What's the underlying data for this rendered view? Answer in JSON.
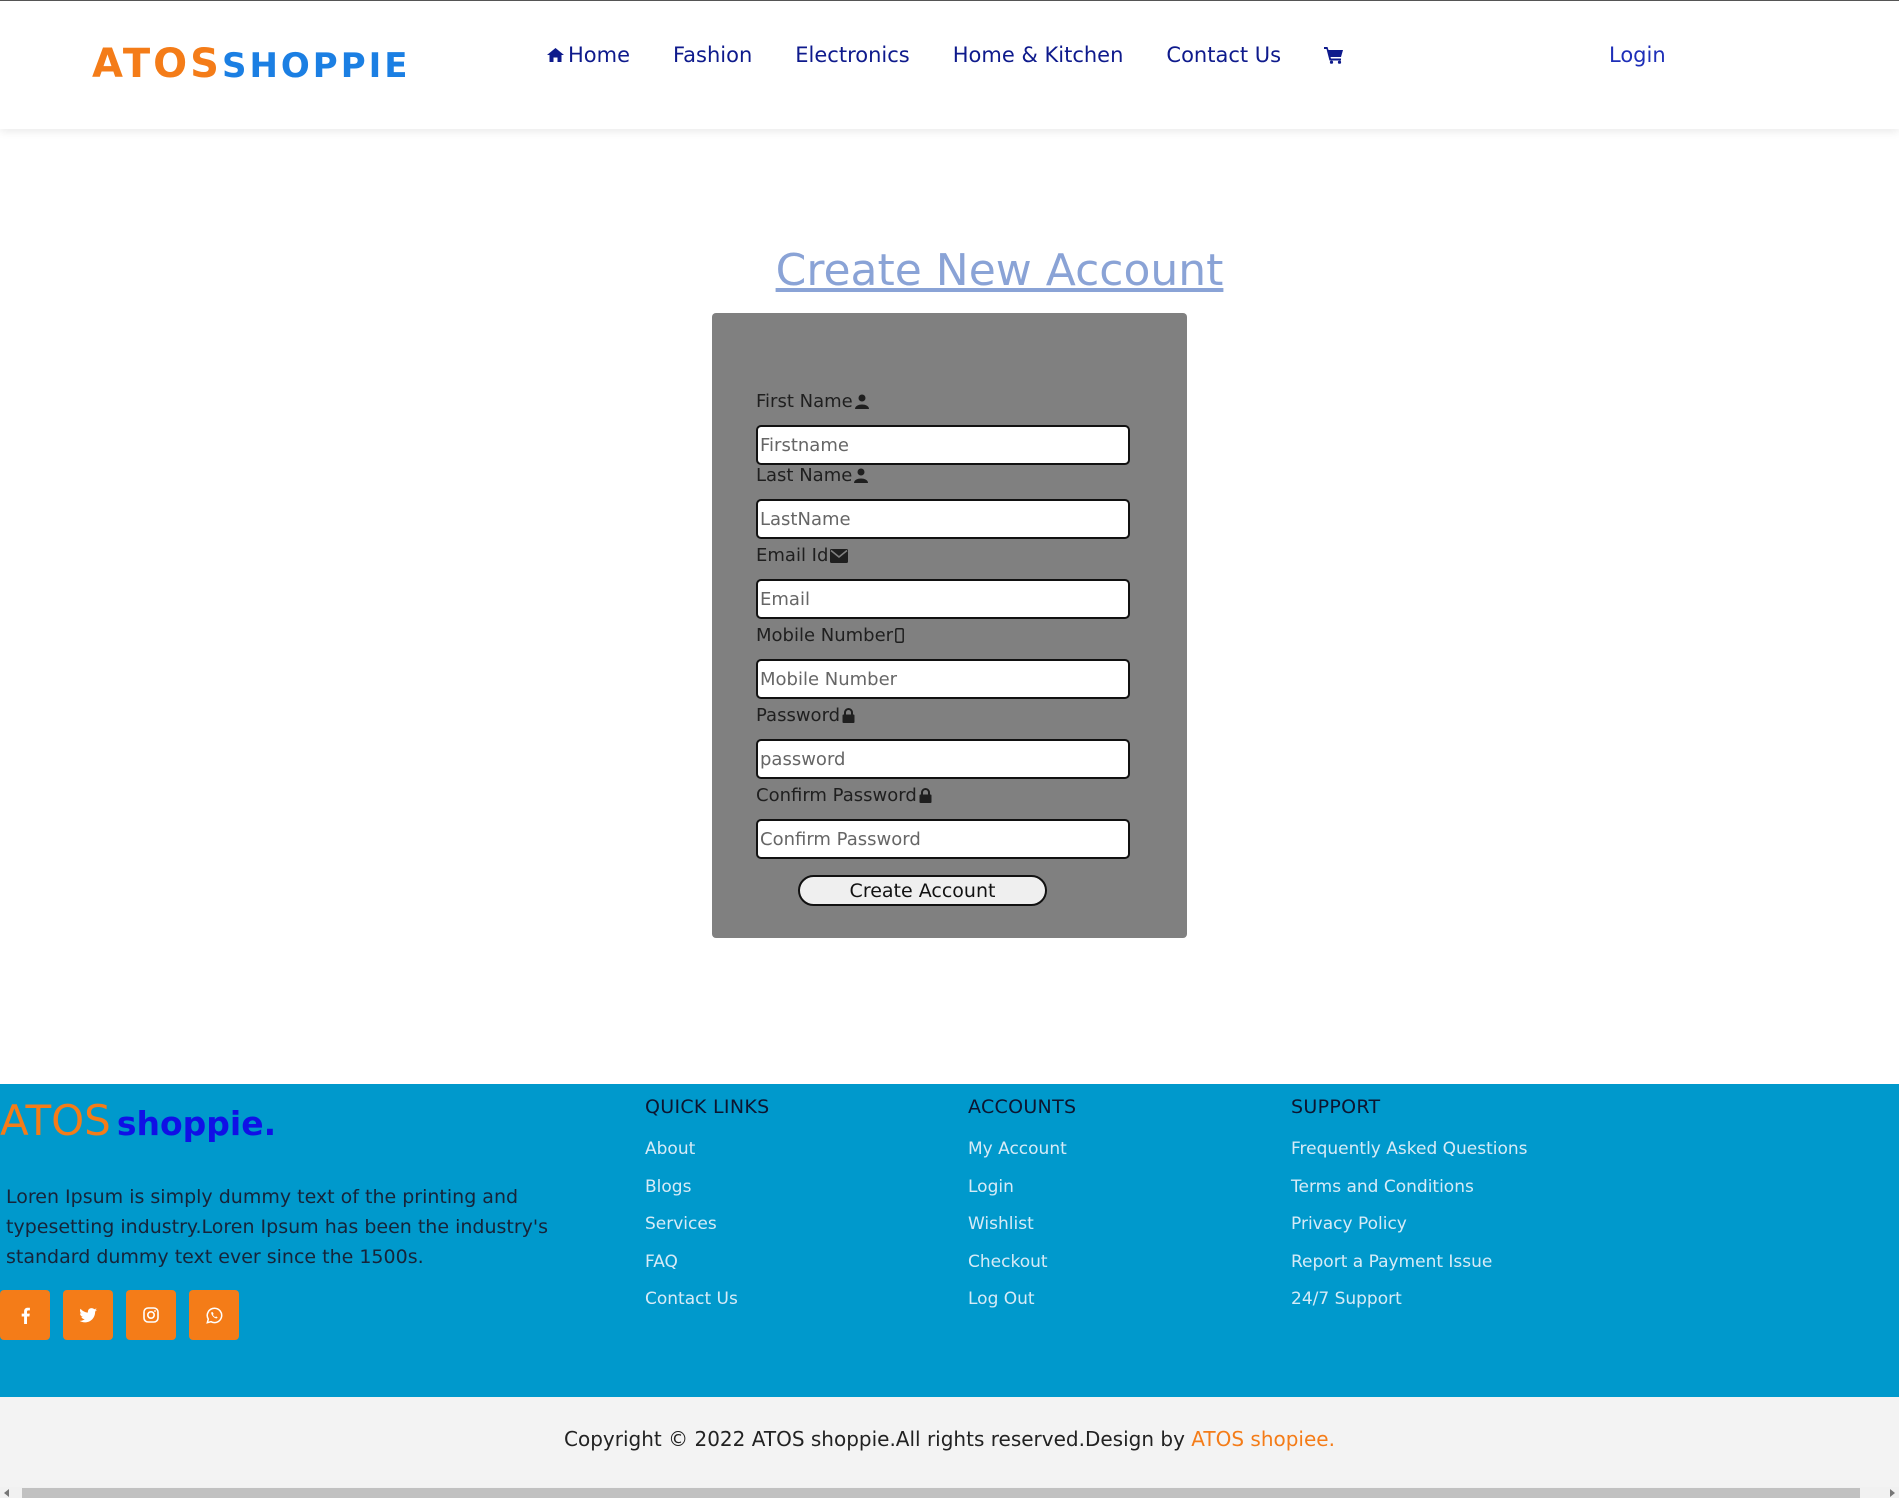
{
  "header": {
    "logo_part1": "ATOS",
    "logo_part2": "SHOPPIE",
    "nav": [
      {
        "label": "Home",
        "icon": "home-icon"
      },
      {
        "label": "Fashion"
      },
      {
        "label": "Electronics"
      },
      {
        "label": "Home & Kitchen"
      },
      {
        "label": "Contact Us"
      }
    ],
    "cart_icon": "cart-icon",
    "login_label": "Login",
    "nav_color": "#0e1a8c"
  },
  "form": {
    "title": "Create New Account",
    "fields": [
      {
        "label": "First Name",
        "icon": "user-icon",
        "placeholder": "Firstname",
        "value": ""
      },
      {
        "label": "Last Name",
        "icon": "user-icon",
        "placeholder": "LastName",
        "value": ""
      },
      {
        "label": "Email Id",
        "icon": "envelope-icon",
        "placeholder": "Email",
        "value": ""
      },
      {
        "label": "Mobile Number",
        "icon": "mobile-icon",
        "placeholder": "Mobile Number",
        "value": ""
      },
      {
        "label": "Password",
        "icon": "lock-icon",
        "placeholder": "password",
        "value": ""
      },
      {
        "label": "Confirm Password",
        "icon": "lock-icon",
        "placeholder": "Confirm Password",
        "value": ""
      }
    ],
    "submit_label": "Create Account",
    "panel_color": "#808080"
  },
  "footer": {
    "logo_part1": "ATOS",
    "logo_part2": "shoppie.",
    "about": "Loren Ipsum is simply dummy text of the printing and typesetting industry.Loren Ipsum has been the industry's standard dummy text ever since the 1500s.",
    "social": [
      {
        "name": "facebook-icon"
      },
      {
        "name": "twitter-icon"
      },
      {
        "name": "instagram-icon"
      },
      {
        "name": "whatsapp-icon"
      }
    ],
    "columns": [
      {
        "title": "QUICK LINKS",
        "links": [
          "About",
          "Blogs",
          "Services",
          "FAQ",
          "Contact Us"
        ]
      },
      {
        "title": "ACCOUNTS",
        "links": [
          "My Account",
          "Login",
          "Wishlist",
          "Checkout",
          "Log Out"
        ]
      },
      {
        "title": "SUPPORT",
        "links": [
          "Frequently Asked Questions",
          "Terms and Conditions",
          "Privacy Policy",
          "Report a Payment Issue",
          "24/7 Support"
        ]
      }
    ],
    "background": "#0099cc",
    "accent": "#f47c18"
  },
  "copyright": {
    "text": "Copyright © 2022 ATOS shoppie.All rights reserved.Design by ",
    "brand": "ATOS shopiee."
  }
}
